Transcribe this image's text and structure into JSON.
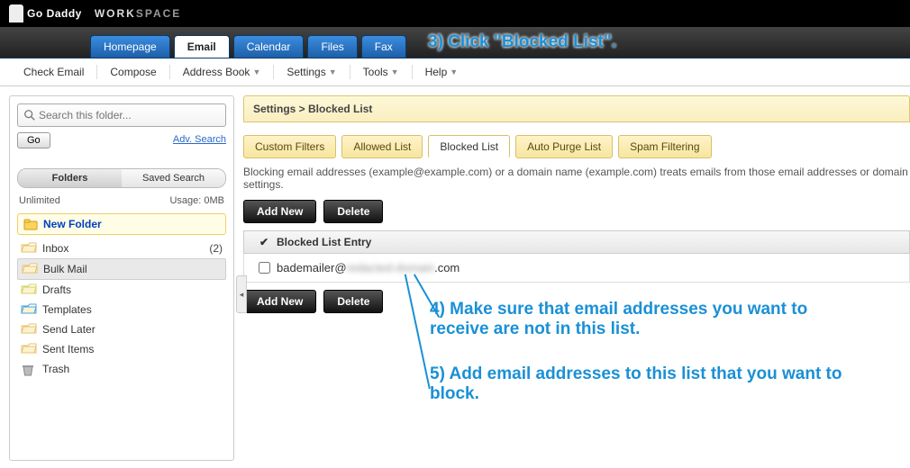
{
  "brand": {
    "go": "Go",
    "daddy": "Daddy",
    "work": "WORK",
    "space": "SPACE"
  },
  "maintabs": [
    "Homepage",
    "Email",
    "Calendar",
    "Files",
    "Fax"
  ],
  "maintabs_active": 1,
  "submenu": [
    {
      "label": "Check Email",
      "drop": false
    },
    {
      "label": "Compose",
      "drop": false
    },
    {
      "label": "Address Book",
      "drop": true
    },
    {
      "label": "Settings",
      "drop": true
    },
    {
      "label": "Tools",
      "drop": true
    },
    {
      "label": "Help",
      "drop": true
    }
  ],
  "search": {
    "placeholder": "Search this folder...",
    "go": "Go",
    "adv": "Adv. Search"
  },
  "foldertabs": [
    "Folders",
    "Saved Search"
  ],
  "quota": {
    "name": "Unlimited",
    "usage": "Usage: 0MB"
  },
  "newfolder": "New Folder",
  "folders": [
    {
      "name": "Inbox",
      "count": "(2)",
      "sel": false
    },
    {
      "name": "Bulk Mail",
      "count": "",
      "sel": true
    },
    {
      "name": "Drafts",
      "count": "",
      "sel": false
    },
    {
      "name": "Templates",
      "count": "",
      "sel": false
    },
    {
      "name": "Send Later",
      "count": "",
      "sel": false
    },
    {
      "name": "Sent Items",
      "count": "",
      "sel": false
    },
    {
      "name": "Trash",
      "count": "",
      "sel": false
    }
  ],
  "breadcrumb": "Settings > Blocked List",
  "settings_tabs": [
    "Custom Filters",
    "Allowed List",
    "Blocked List",
    "Auto Purge List",
    "Spam Filtering"
  ],
  "settings_active": 2,
  "desc": "Blocking email addresses (example@example.com) or a domain name (example.com) treats emails from those email addresses or domain settings.",
  "buttons": {
    "add": "Add New",
    "del": "Delete"
  },
  "table": {
    "header": "Blocked List Entry",
    "check": "✔",
    "rows": [
      {
        "prefix": "bademailer@",
        "mid": "redacted-domain",
        "suffix": ".com"
      }
    ]
  },
  "annotations": {
    "a3": "3) Click \"Blocked List\".",
    "a4": "4) Make sure that email addresses you want to receive are not in this list.",
    "a5": "5) Add email addresses to this list that you want to block."
  }
}
